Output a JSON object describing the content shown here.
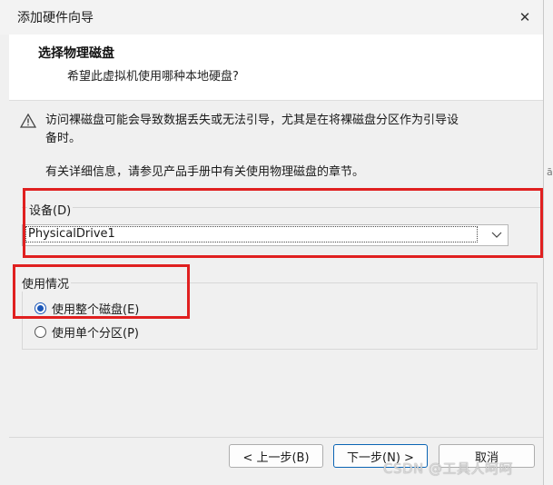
{
  "window": {
    "title": "添加硬件向导",
    "close_glyph": "✕"
  },
  "header": {
    "title": "选择物理磁盘",
    "subtitle": "希望此虚拟机使用哪种本地硬盘?"
  },
  "content": {
    "warning_line1": "访问裸磁盘可能会导致数据丢失或无法引导，尤其是在将裸磁盘分区作为引导设",
    "warning_line2": "备时。",
    "info": "有关详细信息，请参见产品手册中有关使用物理磁盘的章节。"
  },
  "device": {
    "label": "设备(D)",
    "selected": "PhysicalDrive1"
  },
  "usage": {
    "label": "使用情况",
    "options": [
      {
        "label": "使用整个磁盘(E)",
        "checked": true
      },
      {
        "label": "使用单个分区(P)",
        "checked": false
      }
    ]
  },
  "buttons": {
    "back": "< 上一步(B)",
    "next": "下一步(N) >",
    "cancel": "取消"
  },
  "watermark": "CSDN @工具人呵呵",
  "background_fragment": "ā",
  "colors": {
    "highlight_box": "#e02020",
    "radio_accent": "#1a56b8",
    "primary_border": "#0a64b4"
  }
}
